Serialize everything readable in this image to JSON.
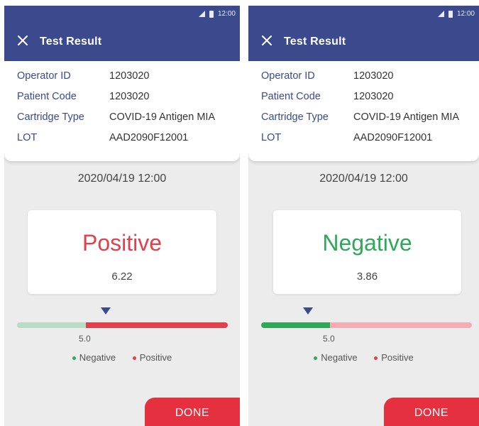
{
  "left": {
    "status_time": "12:00",
    "title": "Test Result",
    "info": [
      {
        "label": "Operator ID",
        "value": "1203020"
      },
      {
        "label": "Patient Code",
        "value": "1203020"
      },
      {
        "label": "Cartridge Type",
        "value": "COVID-19 Antigen MIA"
      },
      {
        "label": "LOT",
        "value": "AAD2090F12001"
      }
    ],
    "datetime": "2020/04/19 12:00",
    "result": "Positive",
    "result_color": "#e0414c",
    "value": "6.22",
    "threshold": "5.0",
    "legend": {
      "negative": "Negative",
      "positive": "Positive"
    },
    "done": "DONE"
  },
  "right": {
    "status_time": "12:00",
    "title": "Test Result",
    "info": [
      {
        "label": "Operator ID",
        "value": "1203020"
      },
      {
        "label": "Patient Code",
        "value": "1203020"
      },
      {
        "label": "Cartridge Type",
        "value": "COVID-19 Antigen MIA"
      },
      {
        "label": "LOT",
        "value": "AAD2090F12001"
      }
    ],
    "datetime": "2020/04/19 12:00",
    "result": "Negative",
    "result_color": "#2fa85a",
    "value": "3.86",
    "threshold": "5.0",
    "legend": {
      "negative": "Negative",
      "positive": "Positive"
    },
    "done": "DONE"
  },
  "colors": {
    "appbar": "#3b4a8c",
    "positive": "#e0414c",
    "positive_light": "#f2aeb4",
    "negative": "#2fa85a",
    "negative_light": "#b9dcc7",
    "done": "#e5303f"
  }
}
